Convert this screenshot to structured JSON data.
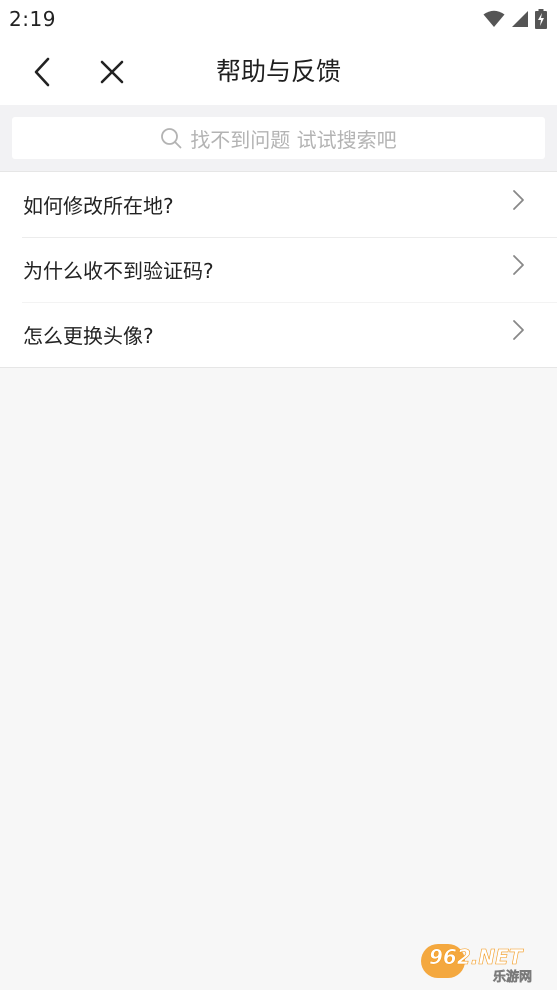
{
  "status_bar": {
    "time": "2:19"
  },
  "header": {
    "title": "帮助与反馈",
    "back_icon": "chevron-left-icon",
    "close_icon": "close-icon"
  },
  "search": {
    "placeholder": "找不到问题 试试搜索吧",
    "icon": "search-icon"
  },
  "faq": {
    "items": [
      {
        "label": "如何修改所在地?"
      },
      {
        "label": "为什么收不到验证码?"
      },
      {
        "label": "怎么更换头像?"
      }
    ]
  },
  "watermark": {
    "brand": "962.NET",
    "subtitle": "乐游网"
  },
  "colors": {
    "background": "#f7f7f7",
    "surface": "#ffffff",
    "search_bg": "#f2f2f4",
    "placeholder": "#b3b3b3",
    "watermark_orange": "#f39a1e"
  }
}
